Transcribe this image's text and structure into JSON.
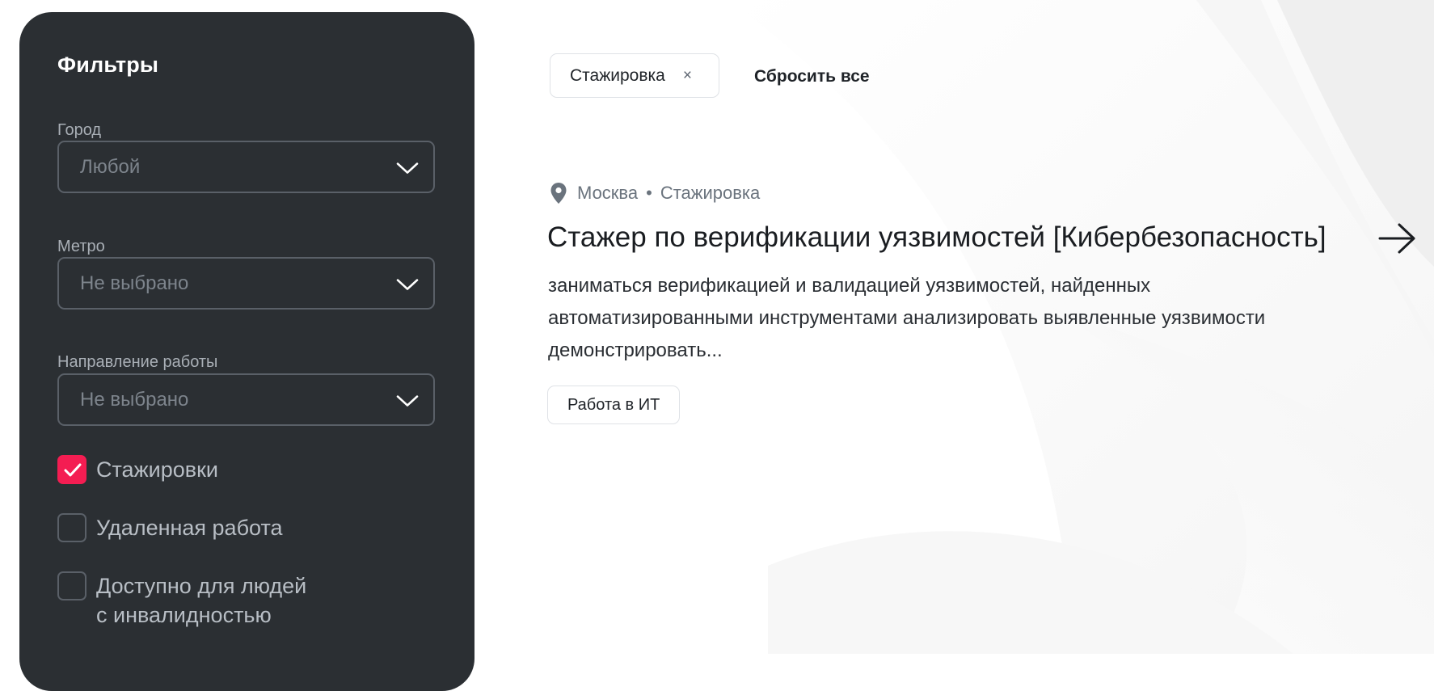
{
  "filters": {
    "title": "Фильтры",
    "city": {
      "label": "Город",
      "value": "Любой"
    },
    "metro": {
      "label": "Метро",
      "value": "Не выбрано"
    },
    "direction": {
      "label": "Направление работы",
      "value": "Не выбрано"
    },
    "checkboxes": [
      {
        "label": "Стажировки",
        "checked": true
      },
      {
        "label": "Удаленная работа",
        "checked": false
      },
      {
        "label_line1": "Доступно для людей",
        "label_line2": "с инвалидностью",
        "checked": false
      }
    ]
  },
  "active_filters": {
    "chips": [
      {
        "label": "Стажировка",
        "close_icon": "×"
      }
    ],
    "reset_label": "Сбросить все"
  },
  "vacancy": {
    "city": "Москва",
    "separator": "•",
    "type": "Стажировка",
    "title": "Стажер по верификации уязвимостей [Кибербезопасность]",
    "description": "заниматься верификацией и валидацией уязвимостей, найденных автоматизированными инструментами анализировать выявленные уязвимости демонстрировать...",
    "tag": "Работа в ИТ"
  },
  "colors": {
    "sidebar_bg": "#2b2f33",
    "accent": "#f41d52"
  }
}
